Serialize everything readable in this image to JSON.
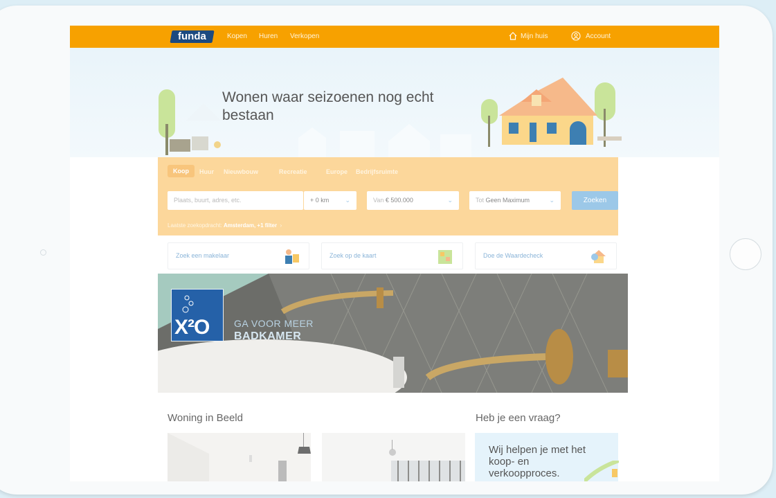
{
  "brand": {
    "logo_text": "funda",
    "color_orange": "#f7a100",
    "color_blue": "#1c4a80"
  },
  "nav": {
    "items": [
      "Kopen",
      "Huren",
      "Verkopen"
    ],
    "mijn_huis": "Mijn huis",
    "account": "Account"
  },
  "hero": {
    "title": "Wonen waar seizoenen nog echt bestaan"
  },
  "search": {
    "tabs": [
      "Koop",
      "Huur",
      "Nieuwbouw",
      "Recreatie",
      "Europe",
      "Bedrijfsruimte"
    ],
    "active_tab": "Koop",
    "location_placeholder": "Plaats, buurt, adres, etc.",
    "radius_value": "+ 0 km",
    "price_from_prefix": "Van",
    "price_from_value": "€ 500.000",
    "price_to_prefix": "Tot",
    "price_to_value": "Geen Maximum",
    "submit_label": "Zoeken",
    "last_search_prefix": "Laatste zoekopdracht:",
    "last_search_value": "Amsterdam, +1 filter"
  },
  "quick_links": [
    "Zoek een makelaar",
    "Zoek op de kaart",
    "Doe de Waardecheck"
  ],
  "banner": {
    "logo_text": "X²O",
    "line1": "GA VOOR MEER",
    "line2": "BADKAMER"
  },
  "sections": {
    "woning_in_beeld": "Woning in Beeld",
    "vraag": "Heb je een vraag?",
    "help_text": "Wij helpen je met het koop- en verkoopproces."
  }
}
